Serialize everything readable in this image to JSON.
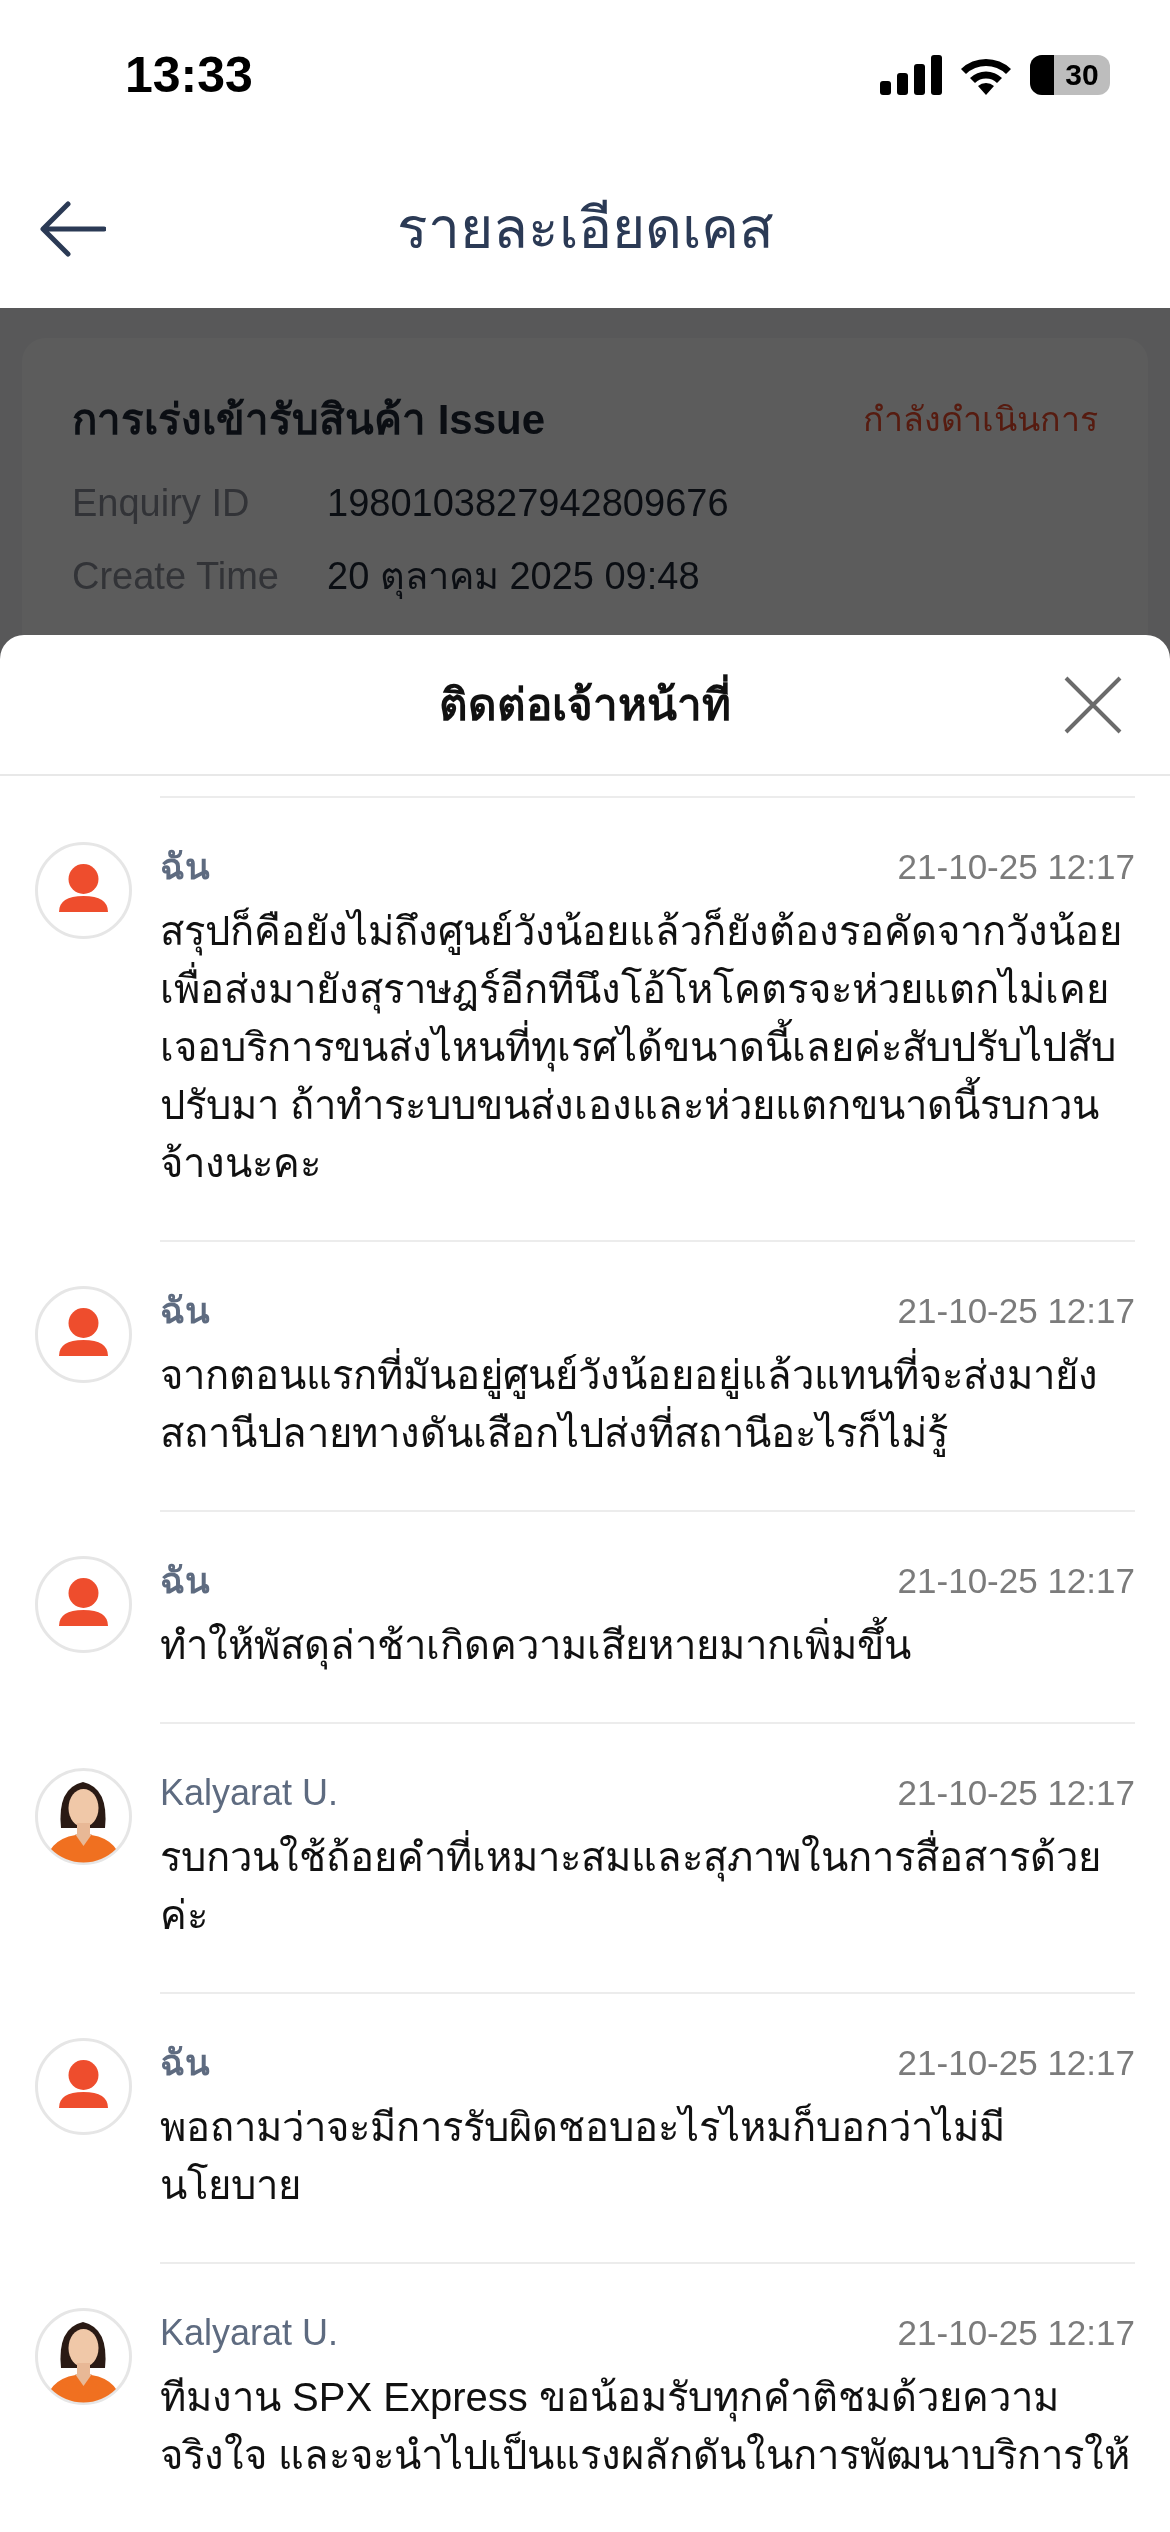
{
  "status_bar": {
    "time": "13:33",
    "battery": "30"
  },
  "header": {
    "title": "รายละเอียดเคส"
  },
  "case": {
    "title": "การเร่งเข้ารับสินค้า Issue",
    "status": "กำลังดำเนินการ",
    "fields": [
      {
        "label": "Enquiry ID",
        "value": "1980103827942809676"
      },
      {
        "label": "Create Time",
        "value": "20 ตุลาคม 2025 09:48"
      }
    ]
  },
  "sheet": {
    "title": "ติดต่อเจ้าหน้าที่"
  },
  "messages": [
    {
      "kind": "user",
      "sender": "ฉัน",
      "time": "21-10-25 12:17",
      "text": "สรุปก็คือยังไม่ถึงศูนย์วังน้อยแล้วก็ยังต้องรอคัดจากวังน้อยเพื่อส่งมายังสุราษฎร์อีกทีนึงโอ้โหโคตรจะห่วยแตกไม่เคยเจอบริการขนส่งไหนที่ทุเรศได้ขนาดนี้เลยค่ะสับปรับไปสับปรับมา ถ้าทำระบบขนส่งเองและห่วยแตกขนาดนี้รบกวนจ้างนะคะ"
    },
    {
      "kind": "user",
      "sender": "ฉัน",
      "time": "21-10-25 12:17",
      "text": "จากตอนแรกที่มันอยู่ศูนย์วังน้อยอยู่แล้วแทนที่จะส่งมายังสถานีปลายทางดันเสือกไปส่งที่สถานีอะไรก็ไม่รู้"
    },
    {
      "kind": "user",
      "sender": "ฉัน",
      "time": "21-10-25 12:17",
      "text": "ทำให้พัสดุล่าช้าเกิดความเสียหายมากเพิ่มขึ้น"
    },
    {
      "kind": "agent",
      "sender": "Kalyarat U.",
      "time": "21-10-25 12:17",
      "text": "รบกวนใช้ถ้อยคำที่เหมาะสมและสุภาพในการสื่อสารด้วยค่ะ"
    },
    {
      "kind": "user",
      "sender": "ฉัน",
      "time": "21-10-25 12:17",
      "text": "พอถามว่าจะมีการรับผิดชอบอะไรไหมก็บอกว่าไม่มีนโยบาย"
    },
    {
      "kind": "agent",
      "sender": "Kalyarat U.",
      "time": "21-10-25 12:17",
      "text": "ทีมงาน SPX Express ขอน้อมรับทุกคำติชมด้วยความจริงใจ และจะนำไปเป็นแรงผลักดันในการพัฒนาบริการให้"
    }
  ]
}
